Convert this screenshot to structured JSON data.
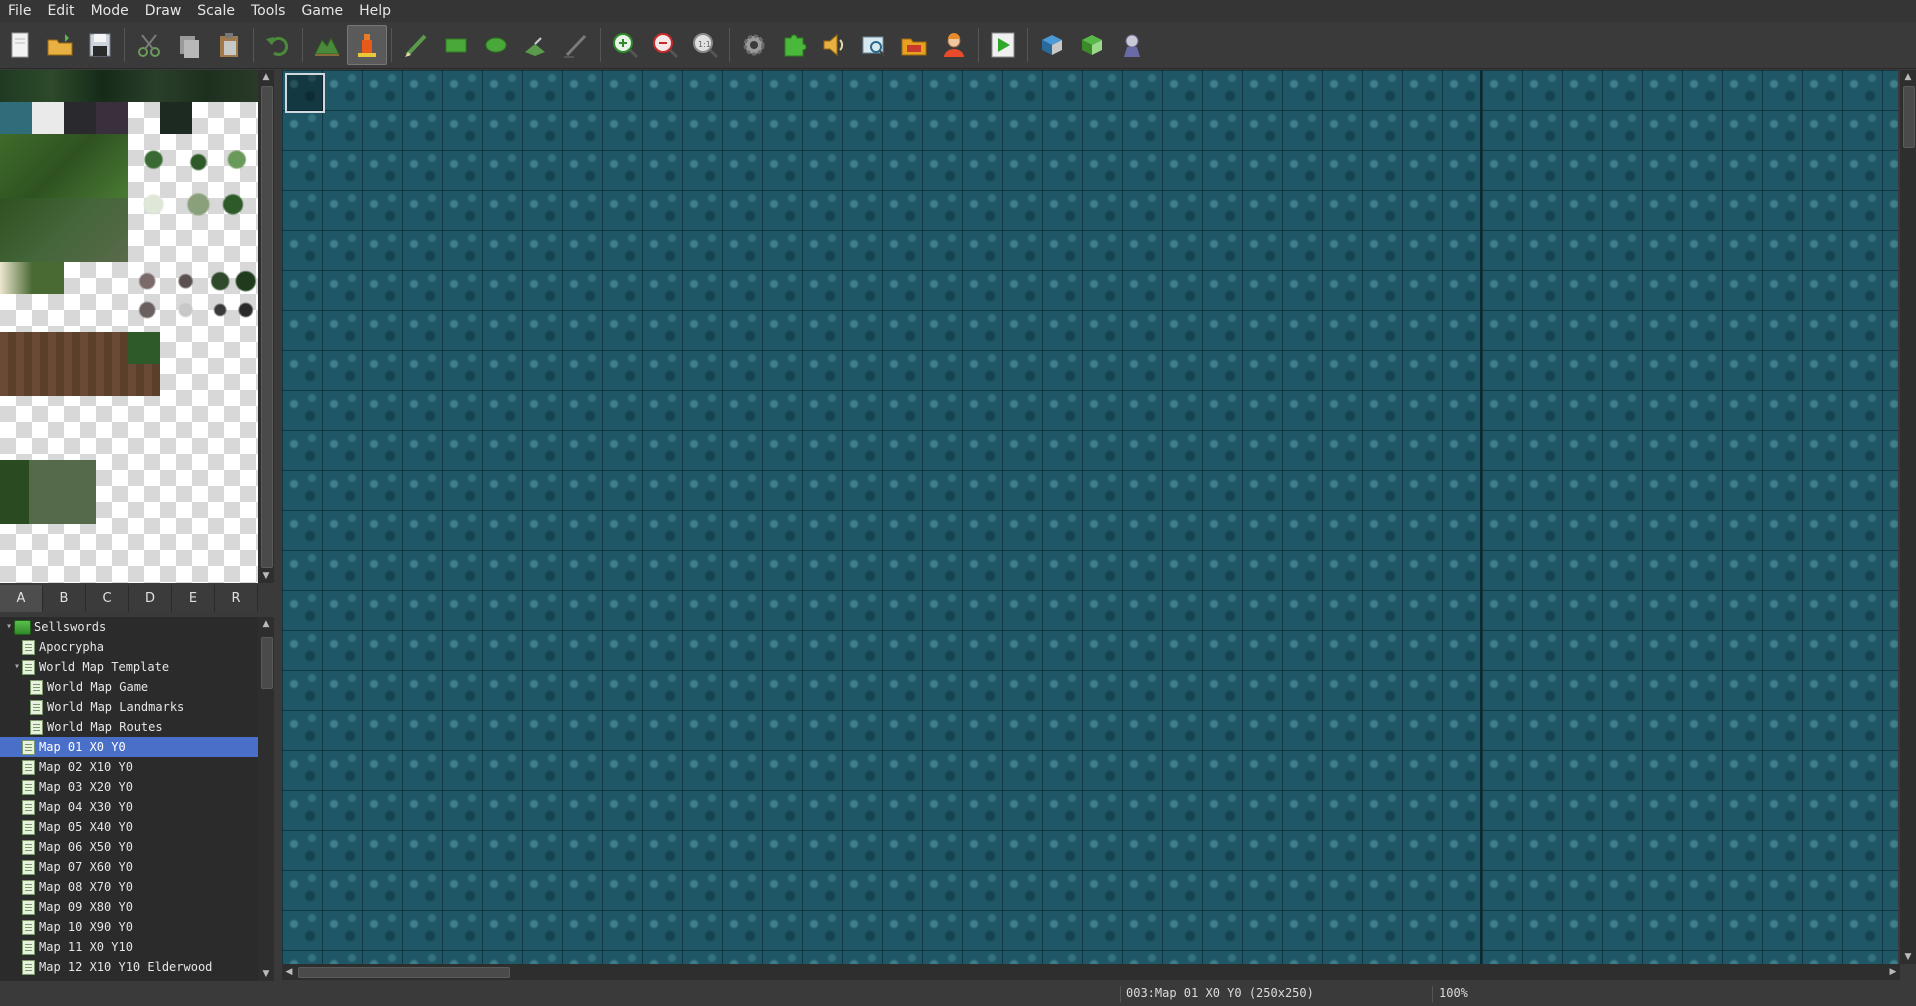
{
  "menu": [
    "File",
    "Edit",
    "Mode",
    "Draw",
    "Scale",
    "Tools",
    "Game",
    "Help"
  ],
  "toolbar": {
    "groups": [
      [
        "new-project",
        "open-project",
        "save-project"
      ],
      [
        "cut",
        "copy",
        "paste"
      ],
      [
        "undo"
      ],
      [
        "map-mode",
        "event-mode"
      ],
      [
        "pencil",
        "rectangle",
        "ellipse",
        "flood-fill",
        "shadow-pen"
      ],
      [
        "zoom-in",
        "zoom-out",
        "zoom-actual-size"
      ],
      [
        "database",
        "plugin-manager",
        "sound-test",
        "event-searcher",
        "resource-manager",
        "character-generator"
      ],
      [
        "playtest"
      ],
      [
        "deployment",
        "steam-management",
        "hero-icon"
      ]
    ],
    "active": [
      "event-mode"
    ]
  },
  "tileset_tabs": [
    "A",
    "B",
    "C",
    "D",
    "E",
    "R"
  ],
  "tileset_active_tab": "A",
  "map_tree": [
    {
      "label": "Sellswords",
      "level": 0,
      "type": "project",
      "expanded": true
    },
    {
      "label": "Apocrypha",
      "level": 1,
      "type": "map"
    },
    {
      "label": "World Map Template",
      "level": 1,
      "type": "map",
      "expanded": true
    },
    {
      "label": "World Map Game",
      "level": 2,
      "type": "map"
    },
    {
      "label": "World Map Landmarks",
      "level": 2,
      "type": "map"
    },
    {
      "label": "World Map Routes",
      "level": 2,
      "type": "map"
    },
    {
      "label": "Map 01 X0 Y0",
      "level": 1,
      "type": "map",
      "selected": true
    },
    {
      "label": "Map 02 X10 Y0",
      "level": 1,
      "type": "map"
    },
    {
      "label": "Map 03 X20 Y0",
      "level": 1,
      "type": "map"
    },
    {
      "label": "Map 04 X30 Y0",
      "level": 1,
      "type": "map"
    },
    {
      "label": "Map 05 X40 Y0",
      "level": 1,
      "type": "map"
    },
    {
      "label": "Map 06 X50 Y0",
      "level": 1,
      "type": "map"
    },
    {
      "label": "Map 07 X60 Y0",
      "level": 1,
      "type": "map"
    },
    {
      "label": "Map 08 X70 Y0",
      "level": 1,
      "type": "map"
    },
    {
      "label": "Map 09 X80 Y0",
      "level": 1,
      "type": "map"
    },
    {
      "label": "Map 10 X90 Y0",
      "level": 1,
      "type": "map"
    },
    {
      "label": "Map 11 X0 Y10",
      "level": 1,
      "type": "map"
    },
    {
      "label": "Map 12 X10 Y10 Elderwood",
      "level": 1,
      "type": "map"
    }
  ],
  "status": {
    "map_info": "003:Map 01 X0 Y0 (250x250)",
    "zoom": "100%"
  },
  "colors": {
    "water": "#1f5766",
    "selection": "#4a6fc8",
    "panel": "#2b2b2b"
  }
}
